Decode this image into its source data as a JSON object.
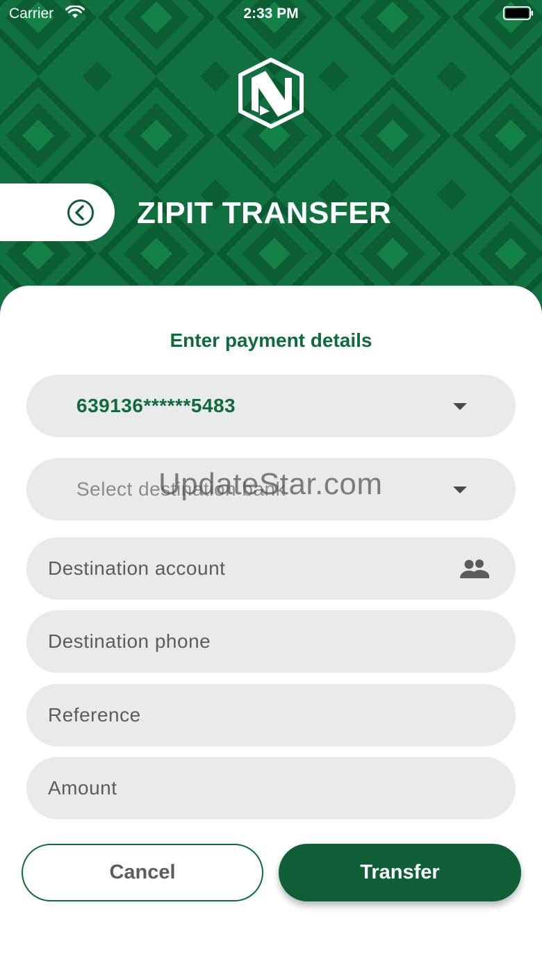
{
  "status_bar": {
    "carrier": "Carrier",
    "time": "2:33 PM"
  },
  "header": {
    "title": "ZIPIT TRANSFER",
    "logo_icon": "nedbank-n-logo-icon",
    "back_icon": "chevron-left-circle-icon"
  },
  "form": {
    "section_title": "Enter payment details",
    "source_account": "639136******5483",
    "destination_bank_placeholder": "Select destination bank",
    "destination_account_placeholder": "Destination account",
    "destination_phone_placeholder": "Destination phone",
    "reference_placeholder": "Reference",
    "amount_placeholder": "Amount"
  },
  "watermark": "UpdateStar.com",
  "actions": {
    "cancel_label": "Cancel",
    "transfer_label": "Transfer"
  },
  "colors": {
    "brand_green": "#0f6b3c",
    "brand_green_dark": "#0f5e37",
    "field_bg": "#e9eaeb"
  }
}
